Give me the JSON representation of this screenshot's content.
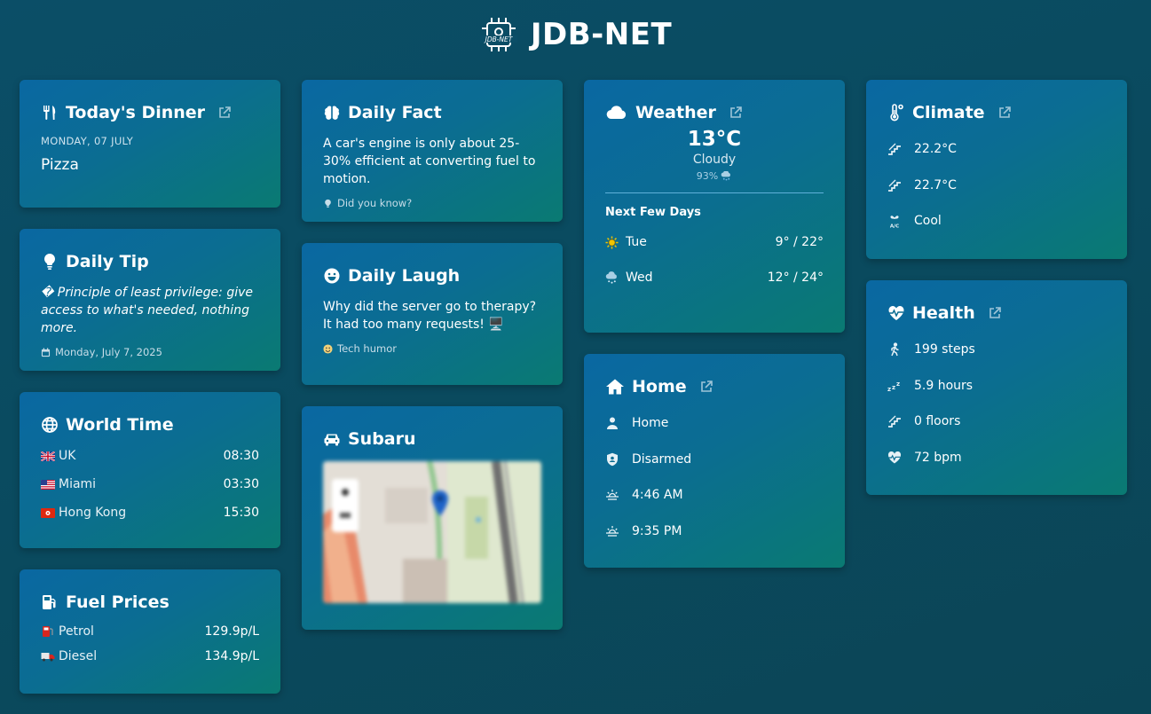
{
  "site": {
    "title": "JDB-NET",
    "logo_text": "JDB-NET"
  },
  "dinner": {
    "title": "Today's Dinner",
    "date": "MONDAY, 07 JULY",
    "meal": "Pizza"
  },
  "tip": {
    "title": "Daily Tip",
    "text": "� Principle of least privilege: give access to what's needed, nothing more.",
    "date": "Monday, July 7, 2025"
  },
  "world_time": {
    "title": "World Time",
    "zones": [
      {
        "city": "UK",
        "time": "08:30",
        "flag": "uk-flag"
      },
      {
        "city": "Miami",
        "time": "03:30",
        "flag": "us-flag"
      },
      {
        "city": "Hong Kong",
        "time": "15:30",
        "flag": "hk-flag"
      }
    ]
  },
  "fuel": {
    "title": "Fuel Prices",
    "items": [
      {
        "label": "Petrol",
        "price": "129.9p/L",
        "icon": "fuel-pump-icon"
      },
      {
        "label": "Diesel",
        "price": "134.9p/L",
        "icon": "truck-icon"
      }
    ]
  },
  "fact": {
    "title": "Daily Fact",
    "text": "A car's engine is only about 25-30% efficient at converting fuel to motion.",
    "footer": "Did you know?"
  },
  "laugh": {
    "title": "Daily Laugh",
    "text": "Why did the server go to therapy? It had too many requests! 🖥️",
    "footer": "Tech humor"
  },
  "car": {
    "title": "Subaru"
  },
  "weather": {
    "title": "Weather",
    "temp": "13°C",
    "condition": "Cloudy",
    "humidity": "93%",
    "forecast_title": "Next Few Days",
    "forecast": [
      {
        "day": "Tue",
        "range": "9° / 22°",
        "icon": "sun-icon"
      },
      {
        "day": "Wed",
        "range": "12° / 24°",
        "icon": "snow-cloud-icon"
      }
    ]
  },
  "home": {
    "title": "Home",
    "items": [
      {
        "label": "Home",
        "icon": "person-icon"
      },
      {
        "label": "Disarmed",
        "icon": "shield-icon"
      },
      {
        "label": "4:46 AM",
        "icon": "sunrise-icon"
      },
      {
        "label": "9:35 PM",
        "icon": "sunset-icon"
      }
    ]
  },
  "climate": {
    "title": "Climate",
    "items": [
      {
        "label": "22.2°C",
        "icon": "stairs-icon"
      },
      {
        "label": "22.7°C",
        "icon": "stairs-icon"
      },
      {
        "label": "Cool",
        "icon": "ac-fan-icon"
      }
    ]
  },
  "health": {
    "title": "Health",
    "items": [
      {
        "label": "199 steps",
        "icon": "walking-icon"
      },
      {
        "label": "5.9 hours",
        "icon": "sleep-icon"
      },
      {
        "label": "0 floors",
        "icon": "stairs-icon"
      },
      {
        "label": "72 bpm",
        "icon": "heart-pulse-icon"
      }
    ]
  },
  "colors": {
    "card_start": "#0a68a2",
    "card_end": "#0a7a72",
    "accent": "#5fb0d9",
    "sun": "#f2c400"
  }
}
